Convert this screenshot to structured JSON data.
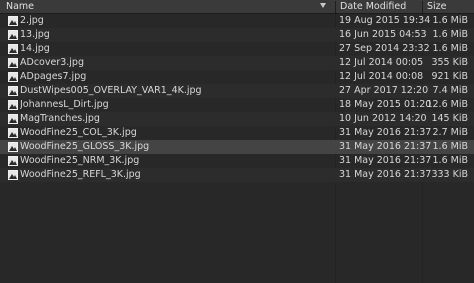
{
  "header": {
    "name_label": "Name",
    "date_label": "Date Modified",
    "size_label": "Size"
  },
  "files": [
    {
      "name": "2.jpg",
      "date": "19 Aug 2015 19:34",
      "size": "1.6 MiB",
      "icon": "image-file-icon"
    },
    {
      "name": "13.jpg",
      "date": "16 Jun 2015 04:53",
      "size": "1.6 MiB",
      "icon": "image-file-icon"
    },
    {
      "name": "14.jpg",
      "date": "27 Sep 2014 23:32",
      "size": "1.6 MiB",
      "icon": "image-file-icon"
    },
    {
      "name": "ADcover3.jpg",
      "date": "12 Jul 2014 00:05",
      "size": "355 KiB",
      "icon": "image-file-icon"
    },
    {
      "name": "ADpages7.jpg",
      "date": "12 Jul 2014 00:08",
      "size": "921 KiB",
      "icon": "image-file-icon"
    },
    {
      "name": "DustWipes005_OVERLAY_VAR1_4K.jpg",
      "date": "27 Apr 2017 12:20",
      "size": "7.4 MiB",
      "icon": "image-file-icon"
    },
    {
      "name": "JohannesL_Dirt.jpg",
      "date": "18 May 2015 01:20",
      "size": "12.6 MiB",
      "icon": "image-file-icon"
    },
    {
      "name": "MagTranches.jpg",
      "date": "10 Jun 2012 14:20",
      "size": "145 KiB",
      "icon": "image-file-icon"
    },
    {
      "name": "WoodFine25_COL_3K.jpg",
      "date": "31 May 2016 21:37",
      "size": "2.7 MiB",
      "icon": "image-file-icon"
    },
    {
      "name": "WoodFine25_GLOSS_3K.jpg",
      "date": "31 May 2016 21:37",
      "size": "1.6 MiB",
      "icon": "image-file-icon",
      "selected": true
    },
    {
      "name": "WoodFine25_NRM_3K.jpg",
      "date": "31 May 2016 21:37",
      "size": "1.6 MiB",
      "icon": "image-file-icon"
    },
    {
      "name": "WoodFine25_REFL_3K.jpg",
      "date": "31 May 2016 21:37",
      "size": "333 KiB",
      "icon": "image-file-icon"
    }
  ],
  "colors": {
    "background": "#282828",
    "header": "#3a3a3a",
    "selected_row": "#444444",
    "text": "#d8d8d8"
  }
}
